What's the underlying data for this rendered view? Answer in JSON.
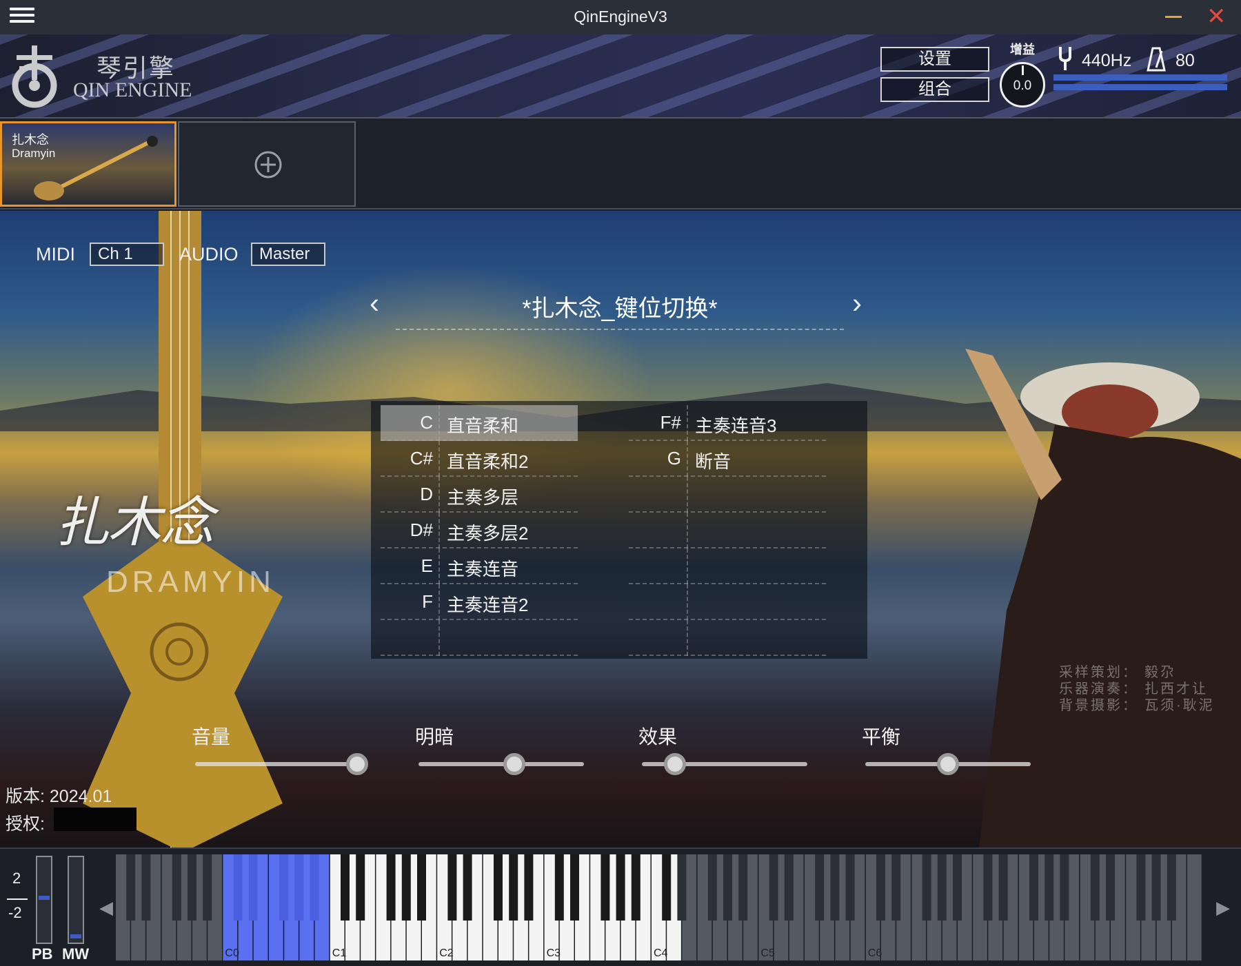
{
  "window": {
    "title": "QinEngineV3"
  },
  "logo": {
    "cn": "琴引擎",
    "en": "QIN ENGINE"
  },
  "header": {
    "settings_label": "设置",
    "combo_label": "组合",
    "gain_label": "增益",
    "gain_value": "0.0",
    "tuning": "440Hz",
    "tempo": "80"
  },
  "slots": [
    {
      "cn": "扎木念",
      "en": "Dramyin",
      "active": true
    },
    {
      "add": true
    }
  ],
  "io": {
    "midi_label": "MIDI",
    "midi_channel": "Ch 1",
    "audio_label": "AUDIO",
    "audio_output": "Master"
  },
  "preset": {
    "name": "*扎木念_键位切换*"
  },
  "brand": {
    "cn": "扎木念",
    "en": "DRAMYIN"
  },
  "keyswitches": {
    "left": [
      {
        "key": "C",
        "name": "直音柔和"
      },
      {
        "key": "C#",
        "name": "直音柔和2"
      },
      {
        "key": "D",
        "name": "主奏多层"
      },
      {
        "key": "D#",
        "name": "主奏多层2"
      },
      {
        "key": "E",
        "name": "主奏连音"
      },
      {
        "key": "F",
        "name": "主奏连音2"
      },
      {
        "key": "",
        "name": ""
      }
    ],
    "right": [
      {
        "key": "F#",
        "name": "主奏连音3"
      },
      {
        "key": "G",
        "name": "断音"
      },
      {
        "key": "",
        "name": ""
      },
      {
        "key": "",
        "name": ""
      },
      {
        "key": "",
        "name": ""
      },
      {
        "key": "",
        "name": ""
      },
      {
        "key": "",
        "name": ""
      }
    ],
    "selected_index": 0
  },
  "credits": [
    {
      "label": "采样策划：",
      "value": "毅尕"
    },
    {
      "label": "乐器演奏：",
      "value": "扎西才让"
    },
    {
      "label": "背景摄影：",
      "value": "瓦须·耿泥"
    }
  ],
  "controls": [
    {
      "label": "音量",
      "value": 0.98
    },
    {
      "label": "明暗",
      "value": 0.58
    },
    {
      "label": "效果",
      "value": 0.2
    },
    {
      "label": "平衡",
      "value": 0.5
    }
  ],
  "footer": {
    "version": "版本: 2024.01",
    "license_label": "授权:"
  },
  "keyboard": {
    "pb_range_up": "2",
    "pb_range_down": "-2",
    "pb_label": "PB",
    "mw_label": "MW",
    "pb_level": 0.45,
    "mw_level": 0.05,
    "octave_labels": [
      "C0",
      "C1",
      "C2",
      "C3",
      "C4",
      "C5",
      "C6"
    ],
    "highlight_color": "#5a70f0"
  }
}
